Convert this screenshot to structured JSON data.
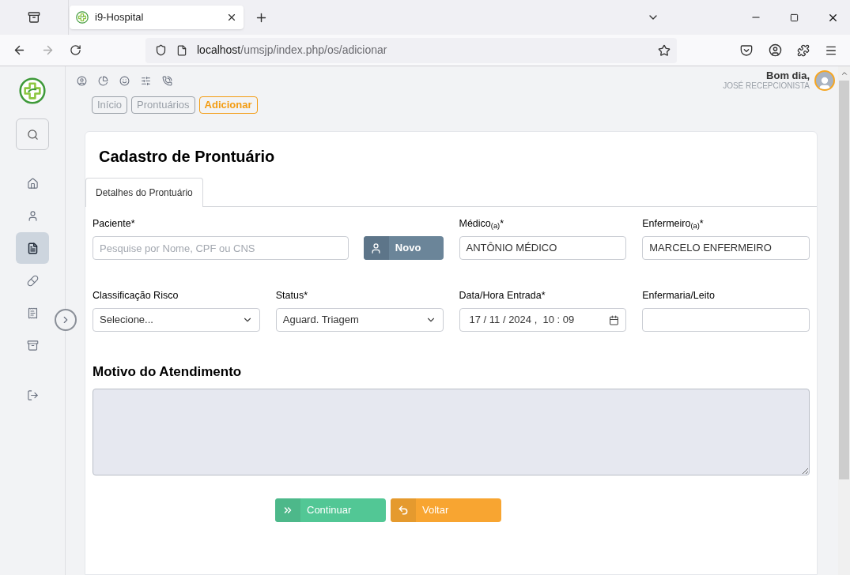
{
  "browser": {
    "tab_title": "i9-Hospital",
    "url_host": "localhost",
    "url_path": "/umsjp/index.php/os/adicionar"
  },
  "sidebar": {
    "items": [
      {
        "kind": "home",
        "selected": false
      },
      {
        "kind": "user",
        "selected": false
      },
      {
        "kind": "document",
        "selected": true
      },
      {
        "kind": "pill",
        "selected": false
      },
      {
        "kind": "report",
        "selected": false
      },
      {
        "kind": "archive",
        "selected": false
      },
      {
        "kind": "logout",
        "selected": false
      }
    ]
  },
  "user": {
    "greeting": "Bom dia,",
    "name": "JOSÉ RECEPCIONISTA"
  },
  "breadcrumbs": [
    {
      "label": "Início",
      "selected": false
    },
    {
      "label": "Prontuários",
      "selected": false
    },
    {
      "label": "Adicionar",
      "selected": true
    }
  ],
  "form": {
    "title": "Cadastro de Prontuário",
    "tabs": [
      {
        "label": "Detalhes do Prontuário",
        "selected": true
      }
    ],
    "patient": {
      "label": "Paciente*",
      "placeholder": "Pesquise por Nome, CPF ou CNS"
    },
    "new_button": {
      "label": "Novo"
    },
    "fields": [
      {
        "kind": "text",
        "label": "Médico$_{(a)}$*",
        "value": "ANTÔNIO MÉDICO"
      },
      {
        "kind": "text",
        "label": "Enfermeiro$_{(a)}$*",
        "value": "MARCELO ENFERMEIRO"
      },
      {
        "kind": "select",
        "label": "Classificação Risco",
        "value": "Selecione..."
      },
      {
        "kind": "select",
        "label": "Status*",
        "value": "Aguard. Triagem"
      },
      {
        "kind": "date",
        "label": "Data/Hora Entrada*",
        "value": "17 / 11 / 2024 ,  10 : 09"
      },
      {
        "kind": "text",
        "label": "Enfermaria/Leito"
      }
    ],
    "reason": {
      "label": "Motivo do Atendimento"
    },
    "buttons": [
      {
        "kind": "continue",
        "label": "Continuar"
      },
      {
        "kind": "back",
        "label": "Voltar"
      }
    ]
  }
}
